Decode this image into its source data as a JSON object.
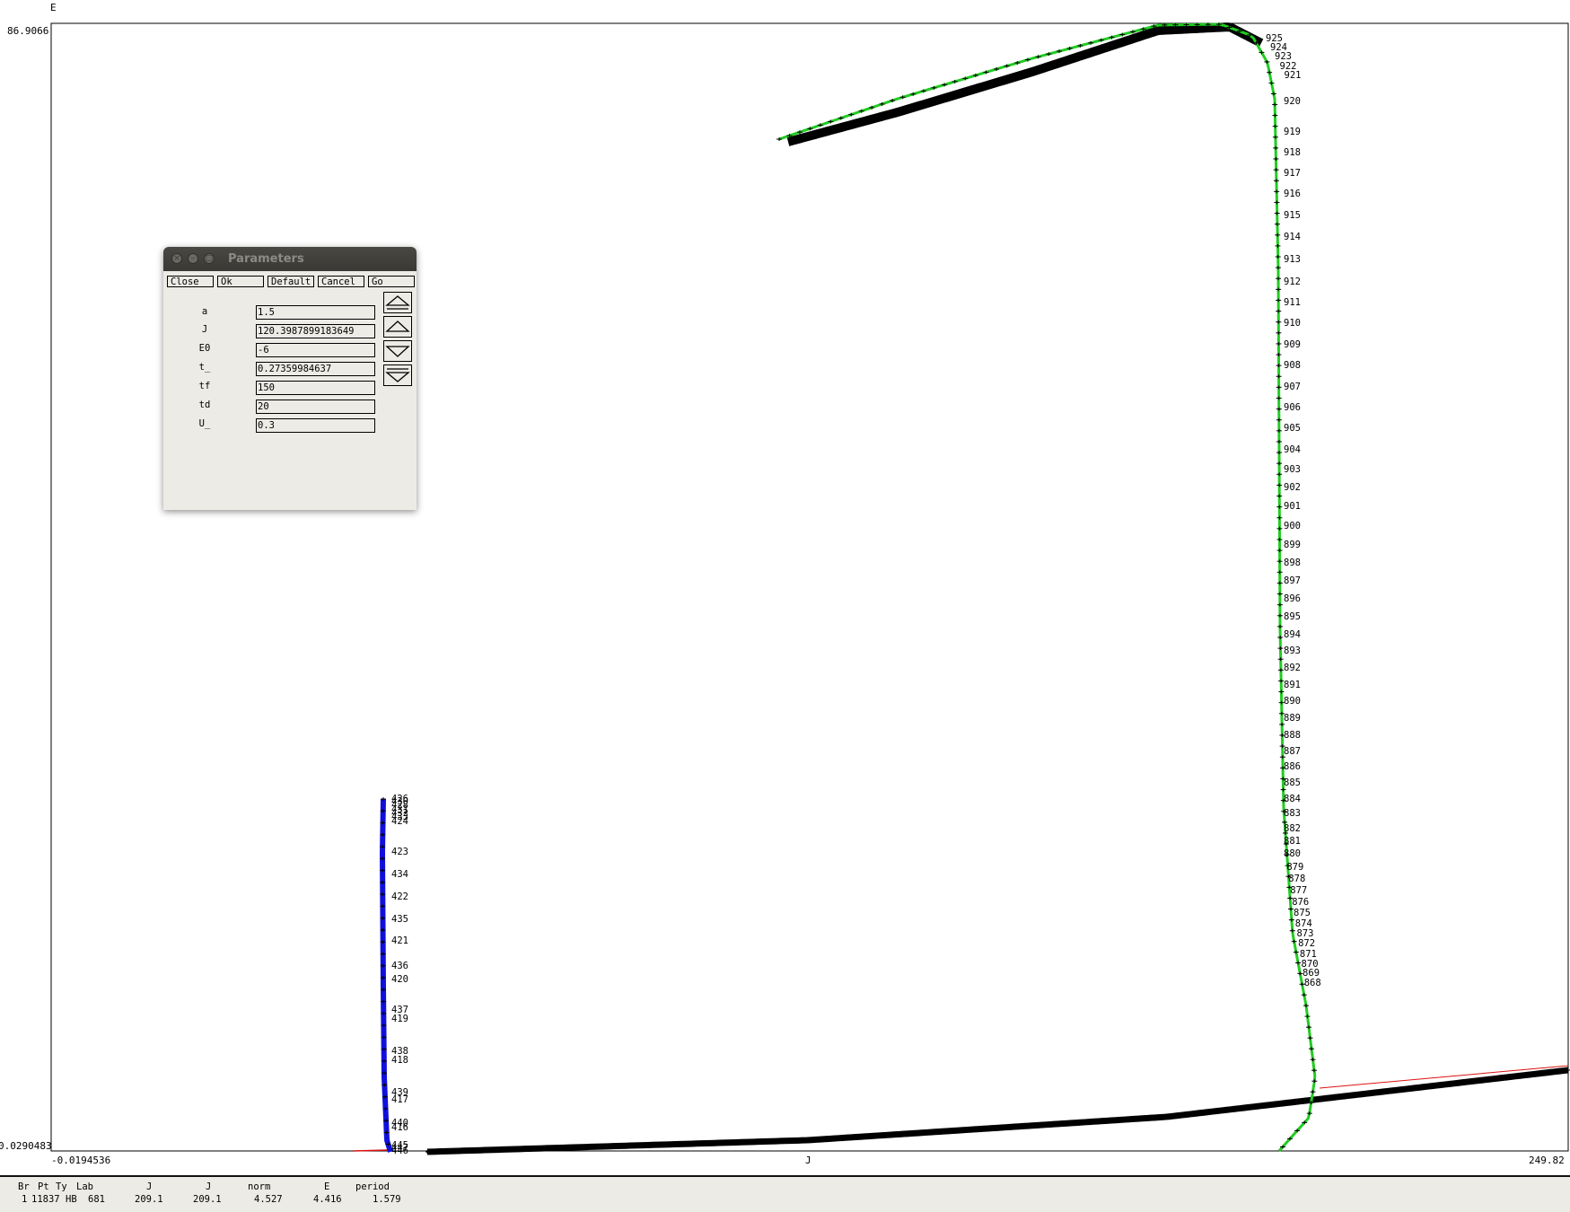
{
  "plot": {
    "y_axis_label": "E",
    "y_max_label": "86.9066",
    "y_min_label": "0.0290483",
    "x_min_label": "-0.0194536",
    "x_axis_label": "J",
    "x_max_label": "249.82"
  },
  "branch_labels": {
    "green": [
      "925",
      "924",
      "923",
      "922",
      "921",
      "920",
      "919",
      "918",
      "917",
      "916",
      "915",
      "914",
      "913",
      "912",
      "911",
      "910",
      "909",
      "908",
      "907",
      "906",
      "905",
      "904",
      "903",
      "902",
      "901",
      "900",
      "899",
      "898",
      "897",
      "896",
      "895",
      "894",
      "893",
      "892",
      "891",
      "890",
      "889",
      "888",
      "887",
      "886",
      "885",
      "884",
      "883",
      "882",
      "881",
      "880",
      "879",
      "878",
      "877",
      "876",
      "875",
      "874",
      "873",
      "872",
      "871",
      "870",
      "869",
      "868"
    ],
    "blue": [
      "426",
      "430",
      "428",
      "431",
      "432",
      "433",
      "424",
      "423",
      "434",
      "422",
      "435",
      "421",
      "436",
      "420",
      "437",
      "419",
      "438",
      "418",
      "439",
      "417",
      "440",
      "416",
      "445",
      "447",
      "446"
    ]
  },
  "param_window": {
    "title": "Parameters",
    "buttons": [
      "Close",
      "Ok",
      "Default",
      "Cancel",
      "Go"
    ],
    "params": [
      {
        "name": "a",
        "value": "1.5"
      },
      {
        "name": "J",
        "value": "120.3987899183649"
      },
      {
        "name": "E0",
        "value": "-6"
      },
      {
        "name": "t_",
        "value": "0.27359984637"
      },
      {
        "name": "tf",
        "value": "150"
      },
      {
        "name": "td",
        "value": "20"
      },
      {
        "name": "U_",
        "value": "0.3"
      }
    ]
  },
  "status": {
    "headers": [
      "Br",
      "Pt",
      "Ty",
      "Lab",
      "J",
      "J",
      "norm",
      "E",
      "period"
    ],
    "values": [
      "1",
      "11837",
      "HB",
      "681",
      "209.1",
      "209.1",
      "4.527",
      "4.416",
      "1.579"
    ]
  },
  "colors": {
    "green_branch": "#22cc22",
    "blue_branch": "#1010dd",
    "red_branch": "#dd1111",
    "marks": "#000000"
  }
}
